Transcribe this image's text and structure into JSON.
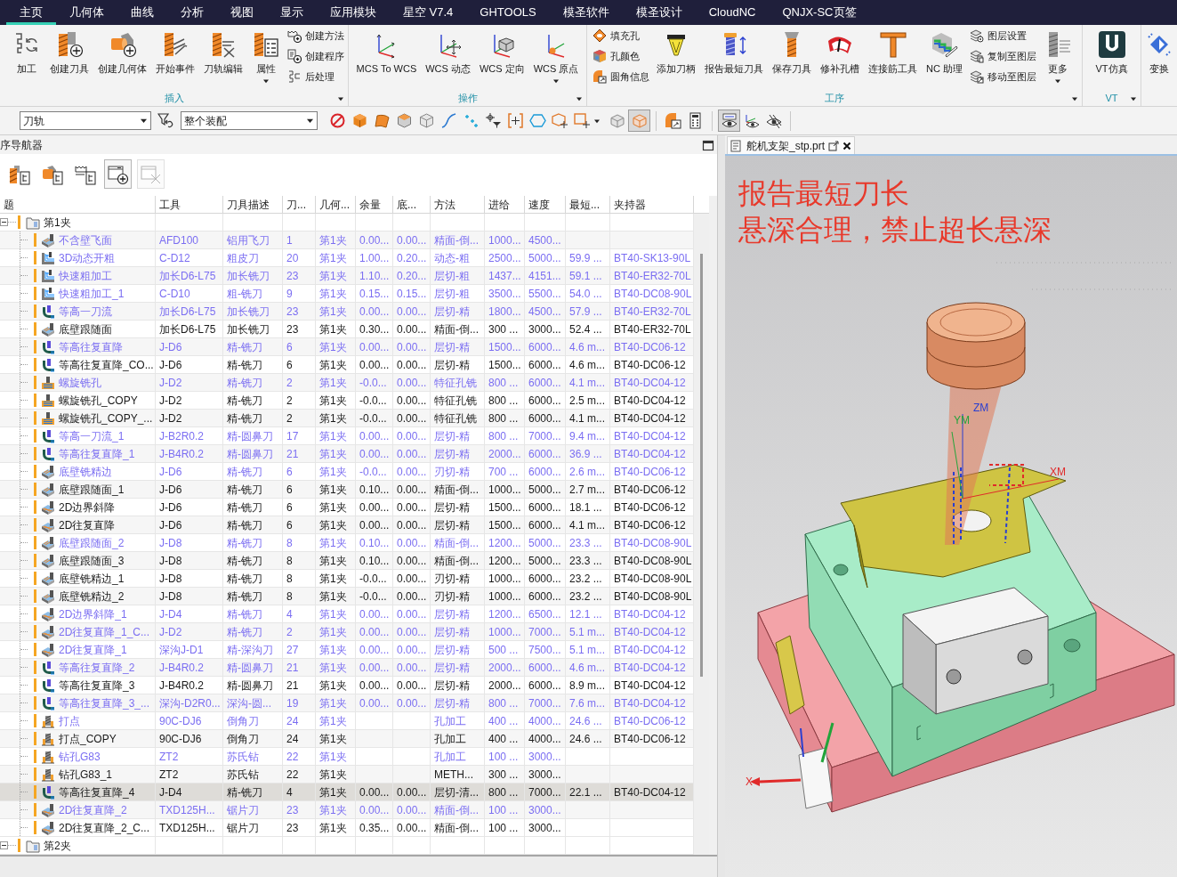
{
  "menu_bar": {
    "tabs": [
      {
        "label": "主页",
        "selected": true
      },
      {
        "label": "几何体",
        "selected": false
      },
      {
        "label": "曲线",
        "selected": false
      },
      {
        "label": "分析",
        "selected": false
      },
      {
        "label": "视图",
        "selected": false
      },
      {
        "label": "显示",
        "selected": false
      },
      {
        "label": "应用模块",
        "selected": false
      },
      {
        "label": "星空 V7.4",
        "selected": false
      },
      {
        "label": "GHTOOLS",
        "selected": false
      },
      {
        "label": "模圣软件",
        "selected": false
      },
      {
        "label": "模圣设计",
        "selected": false
      },
      {
        "label": "CloudNC",
        "selected": false
      },
      {
        "label": "QNJX-SC页签",
        "selected": false
      }
    ]
  },
  "ribbon": {
    "groups": [
      {
        "label": "插入",
        "buttons": [
          {
            "kind": "large",
            "label": "加工",
            "dropdown": false
          },
          {
            "kind": "large",
            "label": "创建刀具",
            "dropdown": false
          },
          {
            "kind": "large",
            "label": "创建几何体",
            "dropdown": false
          },
          {
            "kind": "large",
            "label": "开始事件",
            "dropdown": false
          },
          {
            "kind": "large",
            "label": "刀轨编辑",
            "dropdown": false
          },
          {
            "kind": "large",
            "label": "属性",
            "dropdown": true
          },
          {
            "kind": "stack",
            "items": [
              {
                "label": "创建方法"
              },
              {
                "label": "创建程序"
              },
              {
                "label": "后处理"
              }
            ]
          }
        ]
      },
      {
        "label": "操作",
        "buttons": [
          {
            "kind": "large",
            "label": "MCS To WCS",
            "dropdown": false
          },
          {
            "kind": "large",
            "label": "WCS 动态",
            "dropdown": false
          },
          {
            "kind": "large",
            "label": "WCS 定向",
            "dropdown": false
          },
          {
            "kind": "large",
            "label": "WCS 原点",
            "dropdown": true
          }
        ]
      },
      {
        "label": "工序",
        "buttons": [
          {
            "kind": "stack",
            "items": [
              {
                "label": "填充孔"
              },
              {
                "label": "孔颜色"
              },
              {
                "label": "圆角信息"
              }
            ]
          },
          {
            "kind": "large",
            "label": "添加刀柄",
            "dropdown": false
          },
          {
            "kind": "large",
            "label": "报告最短刀具",
            "dropdown": false
          },
          {
            "kind": "large",
            "label": "保存刀具",
            "dropdown": false
          },
          {
            "kind": "large",
            "label": "修补孔槽",
            "dropdown": false
          },
          {
            "kind": "large",
            "label": "连接筋工具",
            "dropdown": false
          },
          {
            "kind": "large",
            "label": "NC 助理",
            "dropdown": false
          },
          {
            "kind": "stack",
            "items": [
              {
                "label": "图层设置"
              },
              {
                "label": "复制至图层"
              },
              {
                "label": "移动至图层"
              }
            ]
          },
          {
            "kind": "large",
            "label": "更多",
            "dropdown": true
          }
        ]
      },
      {
        "label": "VT",
        "buttons": [
          {
            "kind": "large",
            "label": "VT仿真",
            "dropdown": false
          }
        ]
      },
      {
        "buttons": [
          {
            "kind": "large",
            "label": "变换",
            "dropdown": false
          }
        ]
      }
    ]
  },
  "toolbar": {
    "type_filter": {
      "value": "刀轨"
    },
    "scope_filter": {
      "value": "整个装配"
    },
    "view_toggles": [
      {
        "selected": false
      },
      {
        "selected": true
      }
    ],
    "display_toggles": [
      {
        "selected": true
      },
      {
        "selected": false
      },
      {
        "selected": false
      }
    ]
  },
  "navigator": {
    "title": "序导航器",
    "view_buttons": [
      {
        "disabled": false
      },
      {
        "disabled": false
      },
      {
        "disabled": false
      },
      {
        "disabled": false
      },
      {
        "disabled": true
      }
    ],
    "table": {
      "columns": [
        "题",
        "工具",
        "刀具描述",
        "刀...",
        "几何...",
        "余量",
        "底...",
        "方法",
        "进给",
        "速度",
        "最短...",
        "夹持器"
      ],
      "groups": [
        {
          "label": "第1夹",
          "expanded": true,
          "children": [
            {
              "kind": "face",
              "name": "不含壁飞面",
              "tool": "AFD100",
              "tool_description": "铝用飞刀",
              "column_4": "1",
              "column_5": "第1夹",
              "stock": "0.00...",
              "column_7": "0.00...",
              "method": "精面-倒...",
              "feed": "1000...",
              "speed": "4500...",
              "tinted": true,
              "selected": false
            },
            {
              "kind": "cavity",
              "name": "3D动态开粗",
              "tool": "C-D12",
              "tool_description": "粗皮刀",
              "column_4": "20",
              "column_5": "第1夹",
              "stock": "1.00...",
              "column_7": "0.20...",
              "method": "动态-粗",
              "feed": "2500...",
              "speed": "5000...",
              "column_11": "59.9 ...",
              "holder": "BT40-SK13-90L",
              "tinted": true,
              "selected": false
            },
            {
              "kind": "cavity",
              "name": "快速粗加工",
              "tool": "加长D6-L75",
              "tool_description": "加长铣刀",
              "column_4": "23",
              "column_5": "第1夹",
              "stock": "1.10...",
              "column_7": "0.20...",
              "method": "层切-粗",
              "feed": "1437...",
              "speed": "4151...",
              "column_11": "59.1 ...",
              "holder": "BT40-ER32-70L",
              "tinted": true,
              "selected": false
            },
            {
              "kind": "cavity",
              "name": "快速粗加工_1",
              "tool": "C-D10",
              "tool_description": "粗-铣刀",
              "column_4": "9",
              "column_5": "第1夹",
              "stock": "0.15...",
              "column_7": "0.15...",
              "method": "层切-粗",
              "feed": "3500...",
              "speed": "5500...",
              "column_11": "54.0 ...",
              "holder": "BT40-DC08-90L",
              "tinted": true,
              "selected": false
            },
            {
              "kind": "zlevel",
              "name": "等高一刀流",
              "tool": "加长D6-L75",
              "tool_description": "加长铣刀",
              "column_4": "23",
              "column_5": "第1夹",
              "stock": "0.00...",
              "column_7": "0.00...",
              "method": "层切-精",
              "feed": "1800...",
              "speed": "4500...",
              "column_11": "57.9 ...",
              "holder": "BT40-ER32-70L",
              "tinted": true,
              "selected": false
            },
            {
              "kind": "face",
              "name": "底壁跟随面",
              "tool": "加长D6-L75",
              "tool_description": "加长铣刀",
              "column_4": "23",
              "column_5": "第1夹",
              "stock": "0.30...",
              "column_7": "0.00...",
              "method": "精面-倒...",
              "feed": "300 ...",
              "speed": "3000...",
              "column_11": "52.4 ...",
              "holder": "BT40-ER32-70L",
              "tinted": false,
              "selected": false
            },
            {
              "kind": "zlevel",
              "name": "等高往复直降",
              "tool": "J-D6",
              "tool_description": "精-铣刀",
              "column_4": "6",
              "column_5": "第1夹",
              "stock": "0.00...",
              "column_7": "0.00...",
              "method": "层切-精",
              "feed": "1500...",
              "speed": "6000...",
              "column_11": "4.6 m...",
              "holder": "BT40-DC06-12",
              "tinted": true,
              "selected": false
            },
            {
              "kind": "zlevel",
              "name": "等高往复直降_CO...",
              "tool": "J-D6",
              "tool_description": "精-铣刀",
              "column_4": "6",
              "column_5": "第1夹",
              "stock": "0.00...",
              "column_7": "0.00...",
              "method": "层切-精",
              "feed": "1500...",
              "speed": "6000...",
              "column_11": "4.6 m...",
              "holder": "BT40-DC06-12",
              "tinted": false,
              "selected": false
            },
            {
              "kind": "hole",
              "name": "螺旋铣孔",
              "tool": "J-D2",
              "tool_description": "精-铣刀",
              "column_4": "2",
              "column_5": "第1夹",
              "stock": "-0.0...",
              "column_7": "0.00...",
              "method": "特征孔铣",
              "feed": "800 ...",
              "speed": "6000...",
              "column_11": "4.1 m...",
              "holder": "BT40-DC04-12",
              "tinted": true,
              "selected": false
            },
            {
              "kind": "hole",
              "name": "螺旋铣孔_COPY",
              "tool": "J-D2",
              "tool_description": "精-铣刀",
              "column_4": "2",
              "column_5": "第1夹",
              "stock": "-0.0...",
              "column_7": "0.00...",
              "method": "特征孔铣",
              "feed": "800 ...",
              "speed": "6000...",
              "column_11": "2.5 m...",
              "holder": "BT40-DC04-12",
              "tinted": false,
              "selected": false
            },
            {
              "kind": "hole",
              "name": "螺旋铣孔_COPY_...",
              "tool": "J-D2",
              "tool_description": "精-铣刀",
              "column_4": "2",
              "column_5": "第1夹",
              "stock": "-0.0...",
              "column_7": "0.00...",
              "method": "特征孔铣",
              "feed": "800 ...",
              "speed": "6000...",
              "column_11": "4.1 m...",
              "holder": "BT40-DC04-12",
              "tinted": false,
              "selected": false
            },
            {
              "kind": "zlevel",
              "name": "等高一刀流_1",
              "tool": "J-B2R0.2",
              "tool_description": "精-圆鼻刀",
              "column_4": "17",
              "column_5": "第1夹",
              "stock": "0.00...",
              "column_7": "0.00...",
              "method": "层切-精",
              "feed": "800 ...",
              "speed": "7000...",
              "column_11": "9.4 m...",
              "holder": "BT40-DC04-12",
              "tinted": true,
              "selected": false
            },
            {
              "kind": "zlevel",
              "name": "等高往复直降_1",
              "tool": "J-B4R0.2",
              "tool_description": "精-圆鼻刀",
              "column_4": "21",
              "column_5": "第1夹",
              "stock": "0.00...",
              "column_7": "0.00...",
              "method": "层切-精",
              "feed": "2000...",
              "speed": "6000...",
              "column_11": "36.9 ...",
              "holder": "BT40-DC04-12",
              "tinted": true,
              "selected": false
            },
            {
              "kind": "face",
              "name": "底壁铣精边",
              "tool": "J-D6",
              "tool_description": "精-铣刀",
              "column_4": "6",
              "column_5": "第1夹",
              "stock": "-0.0...",
              "column_7": "0.00...",
              "method": "刃切-精",
              "feed": "700 ...",
              "speed": "6000...",
              "column_11": "2.6 m...",
              "holder": "BT40-DC06-12",
              "tinted": true,
              "selected": false
            },
            {
              "kind": "face",
              "name": "底壁跟随面_1",
              "tool": "J-D6",
              "tool_description": "精-铣刀",
              "column_4": "6",
              "column_5": "第1夹",
              "stock": "0.10...",
              "column_7": "0.00...",
              "method": "精面-倒...",
              "feed": "1000...",
              "speed": "5000...",
              "column_11": "2.7 m...",
              "holder": "BT40-DC06-12",
              "tinted": false,
              "selected": false
            },
            {
              "kind": "planar",
              "name": "2D边界斜降",
              "tool": "J-D6",
              "tool_description": "精-铣刀",
              "column_4": "6",
              "column_5": "第1夹",
              "stock": "0.00...",
              "column_7": "0.00...",
              "method": "层切-精",
              "feed": "1500...",
              "speed": "6000...",
              "column_11": "18.1 ...",
              "holder": "BT40-DC06-12",
              "tinted": false,
              "selected": false
            },
            {
              "kind": "planar",
              "name": "2D往复直降",
              "tool": "J-D6",
              "tool_description": "精-铣刀",
              "column_4": "6",
              "column_5": "第1夹",
              "stock": "0.00...",
              "column_7": "0.00...",
              "method": "层切-精",
              "feed": "1500...",
              "speed": "6000...",
              "column_11": "4.1 m...",
              "holder": "BT40-DC06-12",
              "tinted": false,
              "selected": false
            },
            {
              "kind": "face",
              "name": "底壁跟随面_2",
              "tool": "J-D8",
              "tool_description": "精-铣刀",
              "column_4": "8",
              "column_5": "第1夹",
              "stock": "0.10...",
              "column_7": "0.00...",
              "method": "精面-倒...",
              "feed": "1200...",
              "speed": "5000...",
              "column_11": "23.3 ...",
              "holder": "BT40-DC08-90L",
              "tinted": true,
              "selected": false
            },
            {
              "kind": "face",
              "name": "底壁跟随面_3",
              "tool": "J-D8",
              "tool_description": "精-铣刀",
              "column_4": "8",
              "column_5": "第1夹",
              "stock": "0.10...",
              "column_7": "0.00...",
              "method": "精面-倒...",
              "feed": "1200...",
              "speed": "5000...",
              "column_11": "23.3 ...",
              "holder": "BT40-DC08-90L",
              "tinted": false,
              "selected": false
            },
            {
              "kind": "face",
              "name": "底壁铣精边_1",
              "tool": "J-D8",
              "tool_description": "精-铣刀",
              "column_4": "8",
              "column_5": "第1夹",
              "stock": "-0.0...",
              "column_7": "0.00...",
              "method": "刃切-精",
              "feed": "1000...",
              "speed": "6000...",
              "column_11": "23.2 ...",
              "holder": "BT40-DC08-90L",
              "tinted": false,
              "selected": false
            },
            {
              "kind": "face",
              "name": "底壁铣精边_2",
              "tool": "J-D8",
              "tool_description": "精-铣刀",
              "column_4": "8",
              "column_5": "第1夹",
              "stock": "-0.0...",
              "column_7": "0.00...",
              "method": "刃切-精",
              "feed": "1000...",
              "speed": "6000...",
              "column_11": "23.2 ...",
              "holder": "BT40-DC08-90L",
              "tinted": false,
              "selected": false
            },
            {
              "kind": "planar",
              "name": "2D边界斜降_1",
              "tool": "J-D4",
              "tool_description": "精-铣刀",
              "column_4": "4",
              "column_5": "第1夹",
              "stock": "0.00...",
              "column_7": "0.00...",
              "method": "层切-精",
              "feed": "1200...",
              "speed": "6500...",
              "column_11": "12.1 ...",
              "holder": "BT40-DC04-12",
              "tinted": true,
              "selected": false
            },
            {
              "kind": "planar",
              "name": "2D往复直降_1_C...",
              "tool": "J-D2",
              "tool_description": "精-铣刀",
              "column_4": "2",
              "column_5": "第1夹",
              "stock": "0.00...",
              "column_7": "0.00...",
              "method": "层切-精",
              "feed": "1000...",
              "speed": "7000...",
              "column_11": "5.1 m...",
              "holder": "BT40-DC04-12",
              "tinted": true,
              "selected": false
            },
            {
              "kind": "planar",
              "name": "2D往复直降_1",
              "tool": "深沟J-D1",
              "tool_description": "精-深沟刀",
              "column_4": "27",
              "column_5": "第1夹",
              "stock": "0.00...",
              "column_7": "0.00...",
              "method": "层切-精",
              "feed": "500 ...",
              "speed": "7500...",
              "column_11": "5.1 m...",
              "holder": "BT40-DC04-12",
              "tinted": true,
              "selected": false
            },
            {
              "kind": "zlevel",
              "name": "等高往复直降_2",
              "tool": "J-B4R0.2",
              "tool_description": "精-圆鼻刀",
              "column_4": "21",
              "column_5": "第1夹",
              "stock": "0.00...",
              "column_7": "0.00...",
              "method": "层切-精",
              "feed": "2000...",
              "speed": "6000...",
              "column_11": "4.6 m...",
              "holder": "BT40-DC04-12",
              "tinted": true,
              "selected": false
            },
            {
              "kind": "zlevel",
              "name": "等高往复直降_3",
              "tool": "J-B4R0.2",
              "tool_description": "精-圆鼻刀",
              "column_4": "21",
              "column_5": "第1夹",
              "stock": "0.00...",
              "column_7": "0.00...",
              "method": "层切-精",
              "feed": "2000...",
              "speed": "6000...",
              "column_11": "8.9 m...",
              "holder": "BT40-DC04-12",
              "tinted": false,
              "selected": false
            },
            {
              "kind": "zlevel",
              "name": "等高往复直降_3_...",
              "tool": "深沟-D2R0...",
              "tool_description": "深沟-圆...",
              "column_4": "19",
              "column_5": "第1夹",
              "stock": "0.00...",
              "column_7": "0.00...",
              "method": "层切-精",
              "feed": "800 ...",
              "speed": "7000...",
              "column_11": "7.6 m...",
              "holder": "BT40-DC04-12",
              "tinted": true,
              "selected": false
            },
            {
              "kind": "drill",
              "name": "打点",
              "tool": "90C-DJ6",
              "tool_description": "倒角刀",
              "column_4": "24",
              "column_5": "第1夹",
              "method": "孔加工",
              "feed": "400 ...",
              "speed": "4000...",
              "column_11": "24.6 ...",
              "holder": "BT40-DC06-12",
              "tinted": true,
              "selected": false
            },
            {
              "kind": "drill",
              "name": "打点_COPY",
              "tool": "90C-DJ6",
              "tool_description": "倒角刀",
              "column_4": "24",
              "column_5": "第1夹",
              "method": "孔加工",
              "feed": "400 ...",
              "speed": "4000...",
              "column_11": "24.6 ...",
              "holder": "BT40-DC06-12",
              "tinted": false,
              "selected": false
            },
            {
              "kind": "drill",
              "name": "钻孔G83",
              "tool": "ZT2",
              "tool_description": "苏氏钻",
              "column_4": "22",
              "column_5": "第1夹",
              "method": "孔加工",
              "feed": "100 ...",
              "speed": "3000...",
              "tinted": true,
              "selected": false
            },
            {
              "kind": "drill",
              "name": "钻孔G83_1",
              "tool": "ZT2",
              "tool_description": "苏氏钻",
              "column_4": "22",
              "column_5": "第1夹",
              "method": "METH...",
              "feed": "300 ...",
              "speed": "3000...",
              "tinted": false,
              "selected": false
            },
            {
              "kind": "zlevel",
              "name": "等高往复直降_4",
              "tool": "J-D4",
              "tool_description": "精-铣刀",
              "column_4": "4",
              "column_5": "第1夹",
              "stock": "0.00...",
              "column_7": "0.00...",
              "method": "层切-清...",
              "feed": "800 ...",
              "speed": "7000...",
              "column_11": "22.1 ...",
              "holder": "BT40-DC04-12",
              "tinted": false,
              "selected": true
            },
            {
              "kind": "planar",
              "name": "2D往复直降_2",
              "tool": "TXD125H...",
              "tool_description": "锯片刀",
              "column_4": "23",
              "column_5": "第1夹",
              "stock": "0.00...",
              "column_7": "0.00...",
              "method": "精面-倒...",
              "feed": "100 ...",
              "speed": "3000...",
              "tinted": true,
              "selected": false
            },
            {
              "kind": "planar",
              "name": "2D往复直降_2_C...",
              "tool": "TXD125H...",
              "tool_description": "锯片刀",
              "column_4": "23",
              "column_5": "第1夹",
              "stock": "0.35...",
              "column_7": "0.00...",
              "method": "精面-倒...",
              "feed": "100 ...",
              "speed": "3000...",
              "tinted": false,
              "selected": false
            }
          ]
        },
        {
          "label": "第2夹",
          "expanded": true
        }
      ]
    }
  },
  "graphics": {
    "tab": {
      "label": "舵机支架_stp.prt"
    },
    "notes": [
      "报告最短刀长",
      "悬深合理，禁止超长悬深"
    ],
    "axis_labels": [
      "ZM",
      "YM",
      "XM",
      "X"
    ]
  }
}
